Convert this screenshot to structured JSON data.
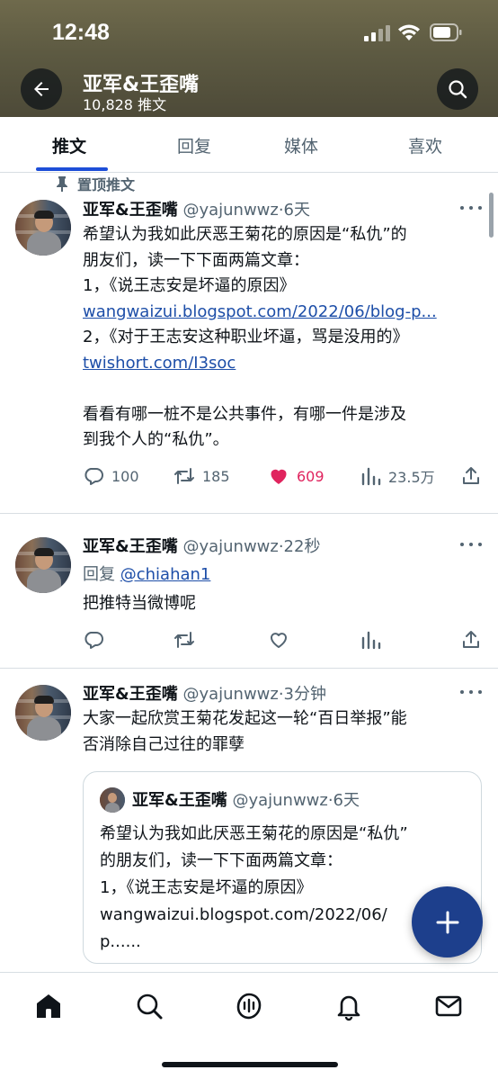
{
  "status_bar": {
    "time": "12:48"
  },
  "header": {
    "profile_name": "亚军&王歪嘴",
    "tweet_count": "10,828 推文"
  },
  "tabs": [
    {
      "label": "推文",
      "active": true
    },
    {
      "label": "回复",
      "active": false
    },
    {
      "label": "媒体",
      "active": false
    },
    {
      "label": "喜欢",
      "active": false
    }
  ],
  "pinned_label": "置顶推文",
  "tweets": [
    {
      "name": "亚军&王歪嘴",
      "handle_time": "@yajunwwz·6天",
      "lines": [
        "希望认为我如此厌恶王菊花的原因是“私仇”的",
        "朋友们，读一下下面两篇文章：",
        "1，《说王志安是坏逼的原因》"
      ],
      "link1": "wangwaizui.blogspot.com/2022/06/blog-p...",
      "line4": "2，《对于王志安这种职业坏逼，骂是没用的》",
      "link2": "twishort.com/I3soc",
      "lines_end": [
        "看看有哪一桩不是公共事件，有哪一件是涉及",
        "到我个人的“私仇”。"
      ],
      "replies": "100",
      "retweets": "185",
      "likes": "609",
      "views": "23.5万"
    },
    {
      "name": "亚军&王歪嘴",
      "handle_time": "@yajunwwz·22秒",
      "reply_prefix": "回复",
      "reply_to": "@chiahan1",
      "text": "把推特当微博呢"
    },
    {
      "name": "亚军&王歪嘴",
      "handle_time": "@yajunwwz·3分钟",
      "lines": [
        "大家一起欣赏王菊花发起这一轮“百日举报”能",
        "否消除自己过往的罪孽"
      ],
      "quote": {
        "name": "亚军&王歪嘴",
        "handle_time": "@yajunwwz·6天",
        "lines": [
          "希望认为我如此厌恶王菊花的原因是“私仇”",
          "的朋友们，读一下下面两篇文章：",
          "1，《说王志安是坏逼的原因》",
          "wangwaizui.blogspot.com/2022/06/",
          "p......"
        ]
      }
    }
  ],
  "icons": [
    "back-arrow-icon",
    "search-icon",
    "pin-icon",
    "more-icon",
    "reply-icon",
    "retweet-icon",
    "heart-icon",
    "views-icon",
    "share-icon",
    "compose-plus-icon",
    "home-icon",
    "spaces-icon",
    "bell-icon",
    "mail-icon"
  ],
  "colors": {
    "accent": "#1d4ed8",
    "like": "#e0245e",
    "link": "#1d4ea8",
    "fab": "#1d3f8c",
    "secondary_text": "#536471"
  }
}
